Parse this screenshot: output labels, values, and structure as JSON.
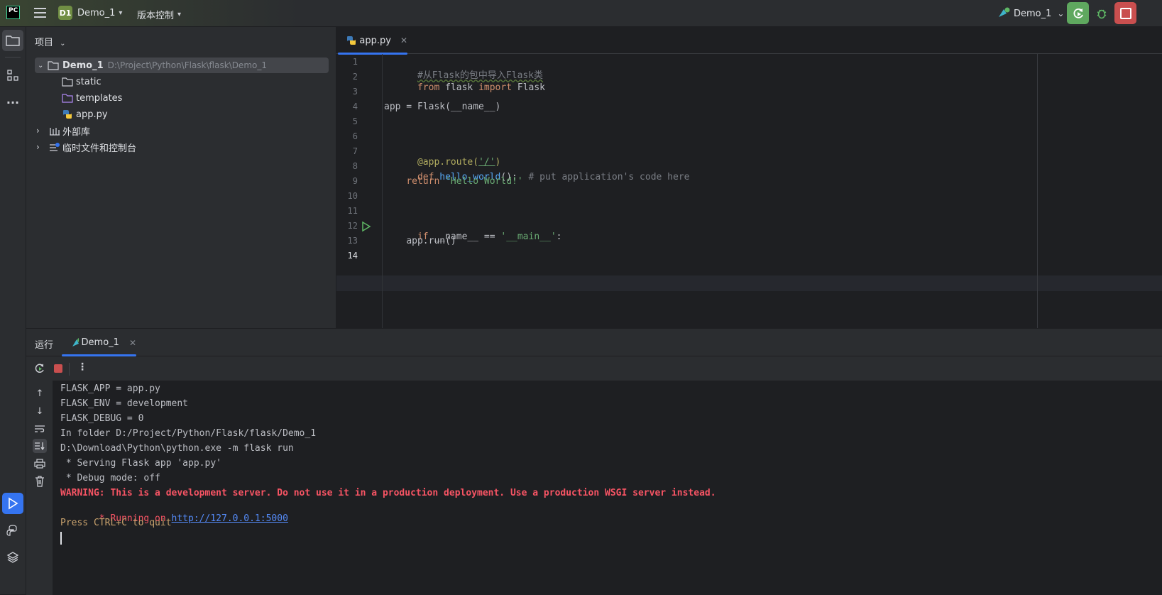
{
  "titlebar": {
    "app_logo": "PC",
    "project_badge": "D1",
    "project_name": "Demo_1",
    "vcs_label": "版本控制",
    "run_config": "Demo_1"
  },
  "project_panel": {
    "title": "项目",
    "root_name": "Demo_1",
    "root_path": "D:\\Project\\Python\\Flask\\flask\\Demo_1",
    "items": [
      {
        "label": "static"
      },
      {
        "label": "templates"
      },
      {
        "label": "app.py"
      }
    ],
    "external_libs": "外部库",
    "scratches": "临时文件和控制台"
  },
  "editor": {
    "tab_name": "app.py",
    "line_numbers": [
      "1",
      "2",
      "3",
      "4",
      "5",
      "6",
      "7",
      "8",
      "9",
      "10",
      "11",
      "12",
      "13",
      "14"
    ],
    "code": {
      "l1": "#从Flask的包中导入Flask类",
      "l2_kw1": "from",
      "l2_mod": " flask ",
      "l2_kw2": "import",
      "l2_rest": " Flask",
      "l4": "app = Flask(__name__)",
      "l7_deco": "@app.route(",
      "l7_str": "'/'",
      "l7_end": ")",
      "l8_kw": "def",
      "l8_fn": "hello_world",
      "l8_paren": "():",
      "l8_cmt": "# put application's code here",
      "l9_kw": "return",
      "l9_str": "'Hello World!'",
      "l12_kw": "if",
      "l12_mid": " __name__ == ",
      "l12_str": "'__main__'",
      "l12_end": ":",
      "l13": "app.run()"
    }
  },
  "run_panel": {
    "title": "运行",
    "tab_name": "Demo_1",
    "console": {
      "line1": "FLASK_APP = app.py",
      "line2": "FLASK_ENV = development",
      "line3": "FLASK_DEBUG = 0",
      "line4": "In folder D:/Project/Python/Flask/flask/Demo_1",
      "line5": "D:\\Download\\Python\\python.exe -m flask run",
      "line6": " * Serving Flask app 'app.py'",
      "line7": " * Debug mode: off",
      "warning": "WARNING: This is a development server. Do not use it in a production deployment. Use a production WSGI server instead.",
      "running_prefix": " * Running on ",
      "running_url": "http://127.0.0.1:5000",
      "quit_hint": "Press CTRL+C to quit"
    }
  },
  "colors": {
    "accent": "#3574f0",
    "run_green": "#5fa85f",
    "stop_red": "#c94f4f",
    "warning_red": "#f75464"
  }
}
